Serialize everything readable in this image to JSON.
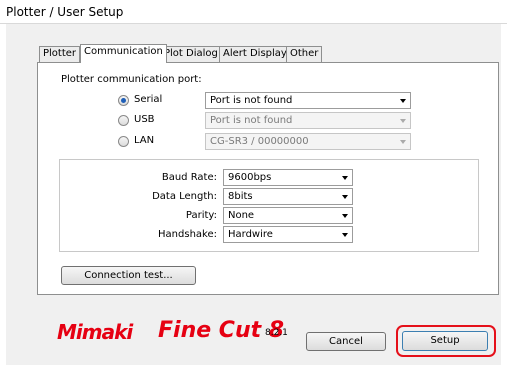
{
  "window": {
    "title": "Plotter / User Setup"
  },
  "tabs": [
    {
      "label": "Plotter"
    },
    {
      "label": "Communication"
    },
    {
      "label": "Plot Dialog"
    },
    {
      "label": "Alert Display"
    },
    {
      "label": "Other"
    }
  ],
  "communication": {
    "port_heading": "Plotter communication port:",
    "ports": [
      {
        "label": "Serial",
        "selected": true,
        "value": "Port is not found",
        "enabled": true
      },
      {
        "label": "USB",
        "selected": false,
        "value": "Port is not found",
        "enabled": false
      },
      {
        "label": "LAN",
        "selected": false,
        "value": "CG-SR3 / 00000000",
        "enabled": false
      }
    ],
    "settings": [
      {
        "label": "Baud Rate:",
        "value": "9600bps"
      },
      {
        "label": "Data Length:",
        "value": "8bits"
      },
      {
        "label": "Parity:",
        "value": "None"
      },
      {
        "label": "Handshake:",
        "value": "Hardwire"
      }
    ],
    "connection_test_label": "Connection test..."
  },
  "footer": {
    "logo_brand": "Mimaki",
    "logo_product": "Fine Cut 8",
    "version": "8.2.1",
    "cancel_label": "Cancel",
    "setup_label": "Setup",
    "highlight_color": "#e5101a"
  },
  "colors": {
    "brand": "#e60012",
    "radio_selected": "#1f5fb8"
  }
}
